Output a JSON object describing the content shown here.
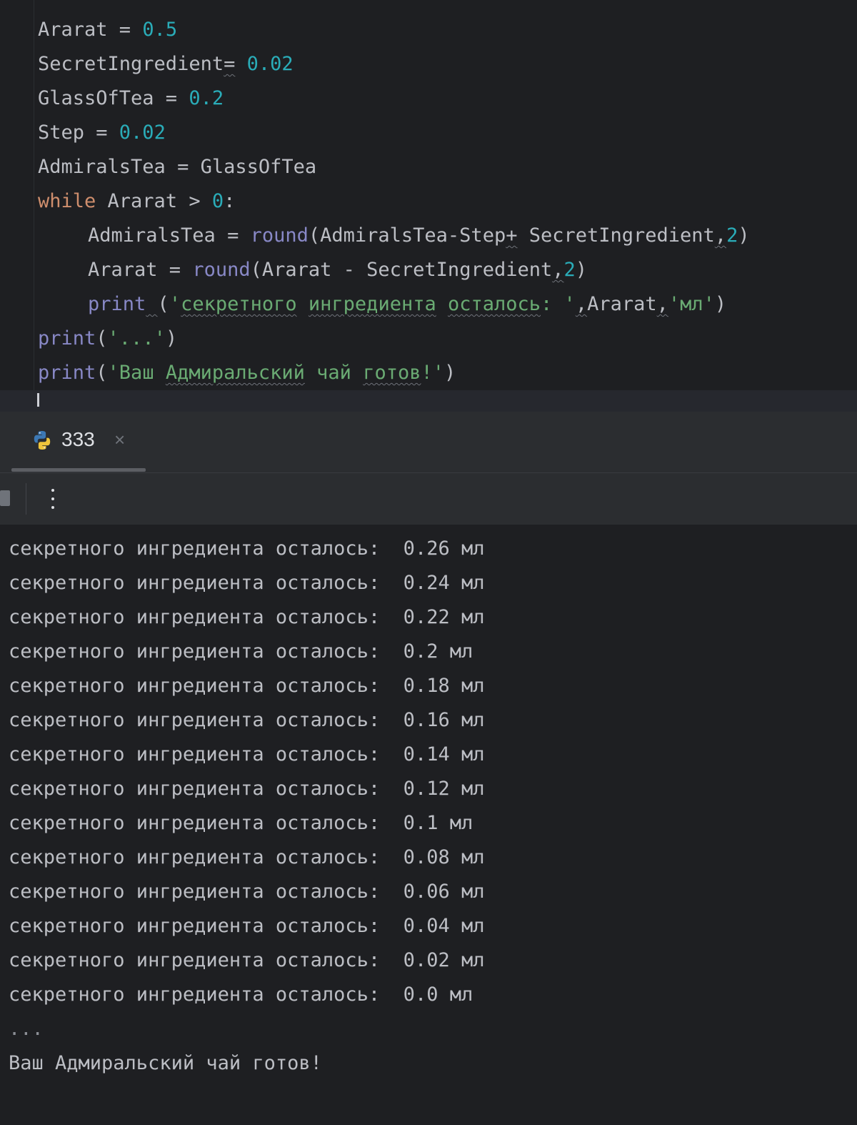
{
  "editor": {
    "code_lines": [
      [
        {
          "t": "Ararat = ",
          "c": ""
        },
        {
          "t": "0.5",
          "c": "num"
        }
      ],
      [
        {
          "t": "SecretIngredient",
          "c": ""
        },
        {
          "t": "=",
          "c": "squig"
        },
        {
          "t": " ",
          "c": ""
        },
        {
          "t": "0.02",
          "c": "num"
        }
      ],
      [
        {
          "t": "GlassOfTea = ",
          "c": ""
        },
        {
          "t": "0.2",
          "c": "num"
        }
      ],
      [
        {
          "t": "Step = ",
          "c": ""
        },
        {
          "t": "0.02",
          "c": "num"
        }
      ],
      [
        {
          "t": "AdmiralsTea = GlassOfTea",
          "c": ""
        }
      ],
      [
        {
          "t": "while",
          "c": "kw"
        },
        {
          "t": " Ararat > ",
          "c": ""
        },
        {
          "t": "0",
          "c": "num"
        },
        {
          "t": ":",
          "c": ""
        }
      ],
      [
        {
          "t": "AdmiralsTea = ",
          "c": ""
        },
        {
          "t": "round",
          "c": "fn"
        },
        {
          "t": "(AdmiralsTea-Step",
          "c": ""
        },
        {
          "t": "+",
          "c": "squig"
        },
        {
          "t": " SecretIngredient",
          "c": ""
        },
        {
          "t": ",",
          "c": "squig"
        },
        {
          "t": "2",
          "c": "num"
        },
        {
          "t": ")",
          "c": ""
        }
      ],
      [
        {
          "t": "Ararat = ",
          "c": ""
        },
        {
          "t": "round",
          "c": "fn"
        },
        {
          "t": "(Ararat - SecretIngredient",
          "c": ""
        },
        {
          "t": ",",
          "c": "squig"
        },
        {
          "t": "2",
          "c": "num"
        },
        {
          "t": ")",
          "c": ""
        }
      ],
      [
        {
          "t": "print",
          "c": "fn"
        },
        {
          "t": " ",
          "c": "squig"
        },
        {
          "t": "(",
          "c": ""
        },
        {
          "t": "'",
          "c": "str"
        },
        {
          "t": "секретного",
          "c": "str squig"
        },
        {
          "t": " ",
          "c": "str"
        },
        {
          "t": "ингредиента",
          "c": "str squig"
        },
        {
          "t": " ",
          "c": "str"
        },
        {
          "t": "осталось",
          "c": "str squig"
        },
        {
          "t": ": '",
          "c": "str"
        },
        {
          "t": ",",
          "c": "squig"
        },
        {
          "t": "Ararat",
          "c": ""
        },
        {
          "t": ",",
          "c": "squig"
        },
        {
          "t": "'мл'",
          "c": "str"
        },
        {
          "t": ")",
          "c": ""
        }
      ],
      [
        {
          "t": "print",
          "c": "fn"
        },
        {
          "t": "(",
          "c": ""
        },
        {
          "t": "'...'",
          "c": "str"
        },
        {
          "t": ")",
          "c": ""
        }
      ],
      [
        {
          "t": "print",
          "c": "fn"
        },
        {
          "t": "(",
          "c": ""
        },
        {
          "t": "'Ваш ",
          "c": "str"
        },
        {
          "t": "Адмиральский",
          "c": "str squig"
        },
        {
          "t": " чай ",
          "c": "str"
        },
        {
          "t": "готов",
          "c": "str squig"
        },
        {
          "t": "!'",
          "c": "str"
        },
        {
          "t": ")",
          "c": ""
        }
      ]
    ]
  },
  "run_panel": {
    "tab_label": "333",
    "tab_close": "×",
    "output_lines": [
      "секретного ингредиента осталось:  0.26 мл",
      "секретного ингредиента осталось:  0.24 мл",
      "секретного ингредиента осталось:  0.22 мл",
      "секретного ингредиента осталось:  0.2 мл",
      "секретного ингредиента осталось:  0.18 мл",
      "секретного ингредиента осталось:  0.16 мл",
      "секретного ингредиента осталось:  0.14 мл",
      "секретного ингредиента осталось:  0.12 мл",
      "секретного ингредиента осталось:  0.1 мл",
      "секретного ингредиента осталось:  0.08 мл",
      "секретного ингредиента осталось:  0.06 мл",
      "секретного ингредиента осталось:  0.04 мл",
      "секретного ингредиента осталось:  0.02 мл",
      "секретного ингредиента осталось:  0.0 мл",
      "...",
      "Ваш Адмиральский чай готов!"
    ]
  },
  "colors": {
    "background": "#1e1f22",
    "keyword": "#cf8e6d",
    "number": "#2aacb8",
    "builtin": "#8888c6",
    "string": "#6aab73",
    "text": "#bcbec4"
  }
}
